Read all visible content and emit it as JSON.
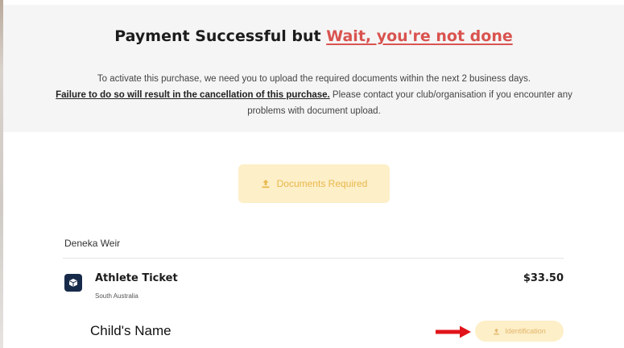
{
  "banner": {
    "title_prefix": "Payment Successful but ",
    "title_accent": "Wait, you're not done",
    "line1": "To activate this purchase, we need you to upload the required documents within the next 2 business days.",
    "warning": "Failure to do so will result in the cancellation of this purchase.",
    "line2_rest": " Please contact your club/organisation if you encounter any",
    "line3": "problems with document upload."
  },
  "documents_button": {
    "label": "Documents Required",
    "icon": "upload-icon"
  },
  "ticket_holder": "Deneka Weir",
  "ticket": {
    "icon": "ticket-icon",
    "title": "Athlete Ticket",
    "subtitle": "South Australia",
    "price": "$33.50"
  },
  "document_row": {
    "label": "Child's Name",
    "button_label": "Identification",
    "arrow_icon": "arrow-right-icon"
  },
  "colors": {
    "accent_red": "#d9534f",
    "button_bg": "#fdefc8",
    "button_text": "#e8b74a",
    "ticket_icon_bg": "#172a4a",
    "arrow_red": "#e0141a"
  }
}
